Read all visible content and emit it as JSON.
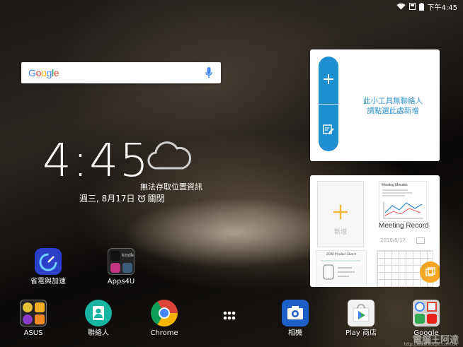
{
  "status_bar": {
    "time": "下午4:45"
  },
  "search": {
    "logo": "Google"
  },
  "clock": {
    "time": "4:45",
    "weather": "無法存取位置資訊",
    "date": "週三, 8月17日",
    "alarm": "關閉"
  },
  "contacts_widget": {
    "line1": "此小工具無聯絡人",
    "line2": "請點選此處新增"
  },
  "notes_widget": {
    "new_label": "新增",
    "note_title": "Meeting Record",
    "note_date": "2016/8/17",
    "thumb1_heading": "Meeting Minutes",
    "thumb2_heading": "ZOM Product Sketch"
  },
  "desktop": [
    {
      "label": "省電與加速"
    },
    {
      "label": "Apps4U",
      "sub_icons": [
        "kindle"
      ]
    }
  ],
  "dock": [
    {
      "label": "ASUS"
    },
    {
      "label": "聯絡人"
    },
    {
      "label": "Chrome"
    },
    {
      "label": ""
    },
    {
      "label": "相機"
    },
    {
      "label": "Play 商店"
    },
    {
      "label": "Google"
    }
  ],
  "watermark": {
    "text": "電腦王阿達",
    "url": "http://www.kocpc.com.tw"
  },
  "colors": {
    "accent_blue": "#1d8fd0",
    "fab_orange": "#f5a623"
  }
}
